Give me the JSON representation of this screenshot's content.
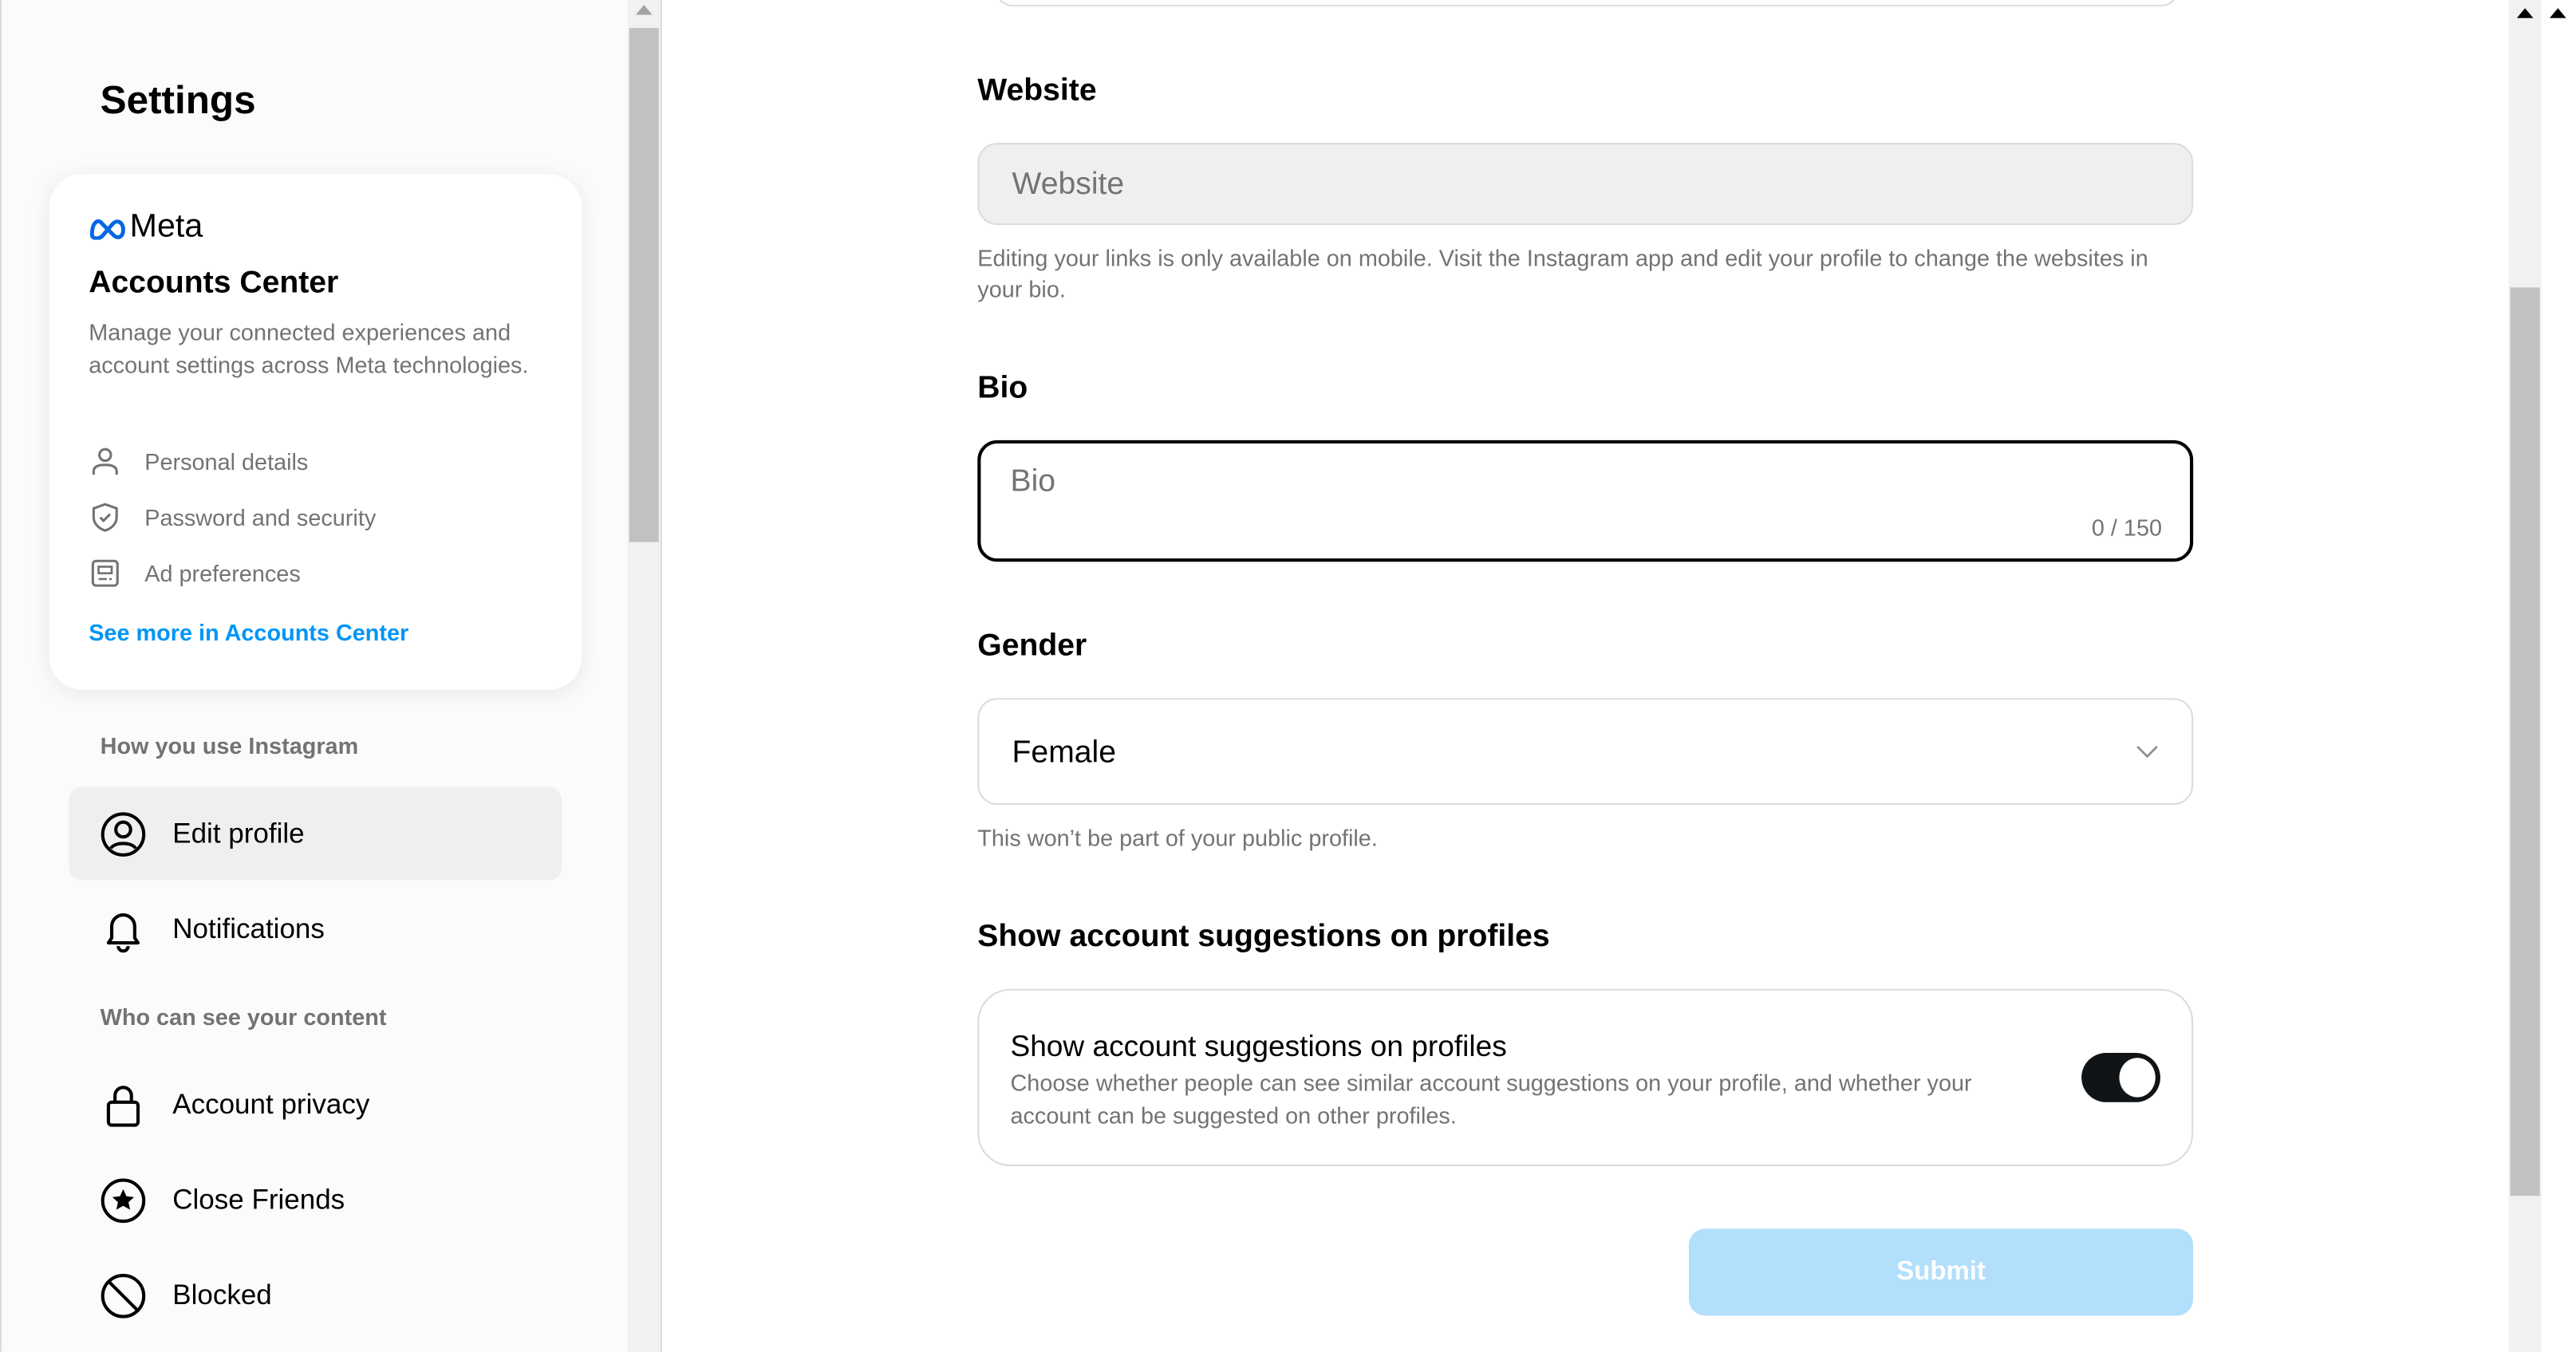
{
  "sidebar": {
    "title": "Settings",
    "accounts_center": {
      "brand": "Meta",
      "title": "Accounts Center",
      "description": "Manage your connected experiences and account settings across Meta technologies.",
      "items": [
        {
          "label": "Personal details",
          "icon": "person-icon"
        },
        {
          "label": "Password and security",
          "icon": "shield-check-icon"
        },
        {
          "label": "Ad preferences",
          "icon": "ad-icon"
        }
      ],
      "link": "See more in Accounts Center"
    },
    "sections": [
      {
        "label": "How you use Instagram",
        "items": [
          {
            "label": "Edit profile",
            "icon": "user-circle-icon",
            "active": true
          },
          {
            "label": "Notifications",
            "icon": "bell-icon"
          }
        ]
      },
      {
        "label": "Who can see your content",
        "items": [
          {
            "label": "Account privacy",
            "icon": "lock-icon"
          },
          {
            "label": "Close Friends",
            "icon": "star-circle-icon"
          },
          {
            "label": "Blocked",
            "icon": "blocked-icon"
          }
        ]
      }
    ]
  },
  "form": {
    "website": {
      "label": "Website",
      "placeholder": "Website",
      "help": "Editing your links is only available on mobile. Visit the Instagram app and edit your profile to change the websites in your bio."
    },
    "bio": {
      "label": "Bio",
      "placeholder": "Bio",
      "counter": "0 / 150"
    },
    "gender": {
      "label": "Gender",
      "value": "Female",
      "help": "This won’t be part of your public profile."
    },
    "suggestions": {
      "label": "Show account suggestions on profiles",
      "title": "Show account suggestions on profiles",
      "description": "Choose whether people can see similar account suggestions on your profile, and whether your account can be suggested on other profiles.",
      "enabled": true
    },
    "submit": "Submit"
  },
  "colors": {
    "accent": "#0095f6",
    "submit_disabled": "#b2dffc",
    "toggle_on": "#101417"
  }
}
